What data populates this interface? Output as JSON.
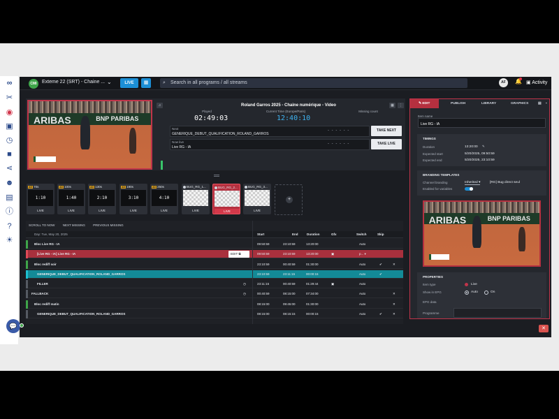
{
  "header": {
    "stream_badge": "CMI",
    "stream_title": "Exteme 22 (SRT) - Chaine ...",
    "live_label": "LIVE",
    "search_placeholder": "Search in all programs / all streams",
    "avatar_initials": "AF",
    "activity_label": "Activity"
  },
  "player": {
    "program_title": "Roland Garros 2025 - Chaine numérique - Video",
    "played_label": "Played",
    "played_value": "02:49:03",
    "current_time_label": "Current Time (Europe/Paris)",
    "current_time_value": "12:40:10",
    "missing_count_label": "Missing count",
    "missing_count_value": "",
    "next_label": "Next",
    "next_item": "GENERIQUE_DEBUT_QUALIFICATION_ROLAND_GARROS",
    "next_dots": "- - - - - -",
    "now_label": "Now live",
    "now_item": "Live RG - IA",
    "now_dots": "- - - - - -",
    "take_next": "TAKE NEXT",
    "take_live": "TAKE LIVE",
    "video_banner_left": "ARIBAS",
    "video_banner_right": "BNP PARIBAS"
  },
  "tiles": [
    {
      "title": "70s",
      "body": "1:10",
      "live": "LIVE"
    },
    {
      "title": "100s",
      "body": "1:40",
      "live": "LIVE"
    },
    {
      "title": "130s",
      "body": "2:10",
      "live": "LIVE"
    },
    {
      "title": "190s",
      "body": "3:10",
      "live": "LIVE"
    },
    {
      "title": "250s",
      "body": "4:10",
      "live": "LIVE"
    },
    {
      "title": "BUG_RG_1...",
      "body": "",
      "live": "LIVE"
    },
    {
      "title": "BUG_RG_2...",
      "body": "",
      "live": "LIVE"
    },
    {
      "title": "BUG_RG_3...",
      "body": "",
      "live": "LIVE"
    }
  ],
  "tile_badge": "AD",
  "playlist": {
    "toolbar": [
      "SCROLL TO NOW",
      "NEXT MISSING",
      "PREVIOUS MISSING"
    ],
    "date_header": "Day: Tue, May 20, 2025",
    "columns": {
      "start": "Start",
      "end": "End",
      "duration": "Duration",
      "gfx": "Gfx",
      "switch": "Switch",
      "skip": "Skip"
    },
    "edit_label": "EDIT",
    "rows": [
      {
        "name": "Bloc Live RG - IA",
        "start": "09:50:59",
        "end": "23:10:59",
        "duration": "13:20:00",
        "switch": "Auto"
      },
      {
        "name": "[Live RG - IA] Live RG - IA",
        "start": "09:50:59",
        "end": "23:10:59",
        "duration": "13:20:00",
        "switch": "p... ▾"
      },
      {
        "name": "Bloc rediff soir",
        "start": "23:10:59",
        "end": "00:40:59",
        "duration": "01:30:00",
        "switch": "Auto"
      },
      {
        "name": "GENERIQUE_DEBUT_QUALIFICATION_ROLAND_GARROS",
        "start": "23:10:59",
        "end": "23:11:15",
        "duration": "00:00:15",
        "switch": "Auto"
      },
      {
        "name": "FILLER",
        "start": "23:11:15",
        "end": "00:40:59",
        "duration": "01:29:44",
        "switch": "Auto"
      },
      {
        "name": "FALLBACK",
        "start": "00:40:59",
        "end": "08:15:00",
        "duration": "07:34:00",
        "switch": "Auto"
      },
      {
        "name": "Bloc rediff matin",
        "start": "08:15:00",
        "end": "09:45:00",
        "duration": "01:30:00",
        "switch": "Auto"
      },
      {
        "name": "GENERIQUE_DEBUT_QUALIFICATION_ROLAND_GARROS",
        "start": "08:15:00",
        "end": "08:15:15",
        "duration": "00:00:15",
        "switch": "Auto"
      }
    ]
  },
  "right_panel": {
    "tabs": [
      "EDIT",
      "PUBLISH",
      "LIBRARY",
      "GRAPHICS"
    ],
    "item_name_label": "Item name",
    "item_name_value": "Live RG - IA",
    "timings_title": "TIMINGS",
    "duration_label": "Duration",
    "duration_value": "13:20:00",
    "expected_start_label": "Expected start",
    "expected_start_value": "5/20/2025, 09:50:59",
    "expected_end_label": "Expected end",
    "expected_end_value": "5/20/2025, 23:10:59",
    "branding_title": "BRANDING TEMPLATES",
    "channel_branding_label": "Channel branding",
    "channel_branding_value": "Inherited",
    "channel_branding_extra": "[RG] Bug direct seul",
    "enabled_variables_label": "Enabled for variables",
    "properties_title": "PROPERTIES",
    "item_type_label": "Item type",
    "item_type_value": "Live",
    "show_in_epg_label": "Show in EPG",
    "show_auto": "Auto",
    "show_on": "On",
    "epg_data_label": "EPG data",
    "programme_label": "Programme"
  },
  "colors": {
    "accent": "#1c8fd6",
    "live_red": "#c0344a",
    "teal": "#138a97",
    "green": "#3fa54a"
  }
}
